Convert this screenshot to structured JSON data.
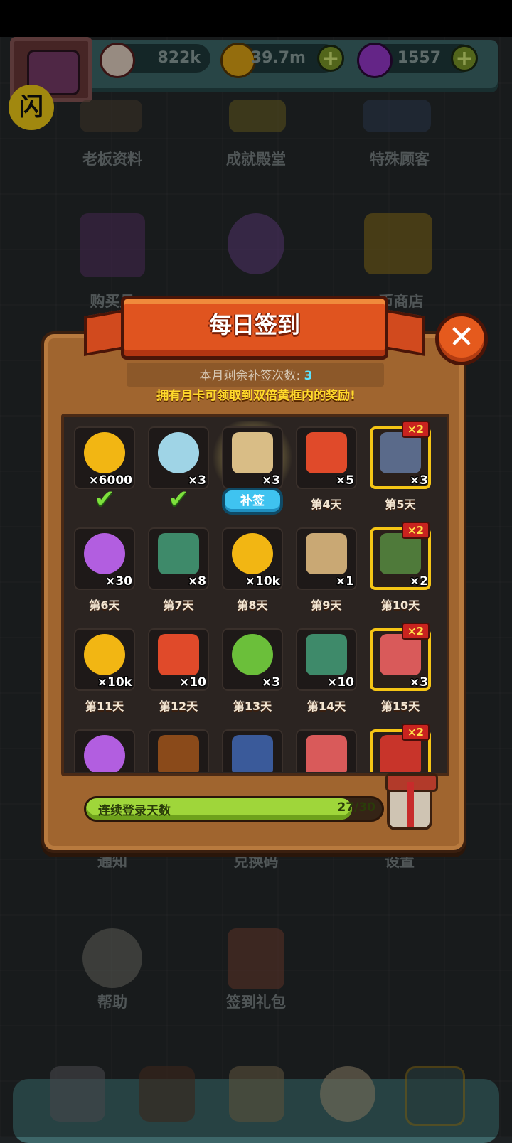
{
  "hud": {
    "eyes": "822k",
    "coins": "39.7m",
    "potions": "1557"
  },
  "menu": {
    "boss_info": "老板资料",
    "achievement_hall": "成就殿堂",
    "special_customers": "特殊顾客",
    "buy_monthly_card": "购买月",
    "coin_shop": "币商店",
    "notice": "通知",
    "redeem_code": "兑换码",
    "settings": "设置",
    "help": "帮助",
    "signin_gift": "签到礼包"
  },
  "dialog": {
    "title": "每日签到",
    "remaining_label": "本月剩余补签次数:",
    "remaining_count": "3",
    "hint": "拥有月卡可领取到双倍黄框内的奖励!",
    "resign_label": "补签",
    "double_badge": "×2",
    "progress_label": "连续登录天数",
    "progress_count": "27/30",
    "progress_fraction": 0.9
  },
  "days": [
    {
      "qty": "×6000",
      "day": "",
      "status": "claimed",
      "icon": "gold-coin-icon",
      "color": "#f2b613",
      "gold": false
    },
    {
      "qty": "×3",
      "day": "",
      "status": "claimed",
      "icon": "crystal-orb-icon",
      "color": "#9fd4e6",
      "gold": false
    },
    {
      "qty": "×3",
      "day": "",
      "status": "resign",
      "icon": "treasure-map-icon",
      "color": "#d9bd86",
      "gold": false
    },
    {
      "qty": "×5",
      "day": "第4天",
      "status": "pending",
      "icon": "capsule-icon",
      "color": "#e04a2a",
      "gold": false
    },
    {
      "qty": "×3",
      "day": "第5天",
      "status": "pending",
      "icon": "hero-card-icon",
      "color": "#5a6a8a",
      "gold": true
    },
    {
      "qty": "×30",
      "day": "第6天",
      "status": "pending",
      "icon": "purple-potion-icon",
      "color": "#b25ee0",
      "gold": false
    },
    {
      "qty": "×8",
      "day": "第7天",
      "status": "pending",
      "icon": "blueprint-icon",
      "color": "#3e8a6a",
      "gold": false
    },
    {
      "qty": "×10k",
      "day": "第8天",
      "status": "pending",
      "icon": "gold-coin-icon",
      "color": "#f2b613",
      "gold": false
    },
    {
      "qty": "×1",
      "day": "第9天",
      "status": "pending",
      "icon": "ticket-icon",
      "color": "#c9a874",
      "gold": false
    },
    {
      "qty": "×2",
      "day": "第10天",
      "status": "pending",
      "icon": "monster-card-icon",
      "color": "#4f7a3a",
      "gold": true
    },
    {
      "qty": "×10k",
      "day": "第11天",
      "status": "pending",
      "icon": "gold-coin-icon",
      "color": "#f2b613",
      "gold": false
    },
    {
      "qty": "×10",
      "day": "第12天",
      "status": "pending",
      "icon": "capsule-icon",
      "color": "#e04a2a",
      "gold": false
    },
    {
      "qty": "×3",
      "day": "第13天",
      "status": "pending",
      "icon": "green-potion-icon",
      "color": "#6bbf3a",
      "gold": false
    },
    {
      "qty": "×10",
      "day": "第14天",
      "status": "pending",
      "icon": "blueprint-icon",
      "color": "#3e8a6a",
      "gold": false
    },
    {
      "qty": "×3",
      "day": "第15天",
      "status": "pending",
      "icon": "scroll-icon",
      "color": "#d95a5a",
      "gold": true
    },
    {
      "qty": "",
      "day": "",
      "status": "pending",
      "icon": "purple-potion-icon",
      "color": "#b25ee0",
      "gold": false
    },
    {
      "qty": "",
      "day": "",
      "status": "pending",
      "icon": "herb-icon",
      "color": "#8a4a1a",
      "gold": false
    },
    {
      "qty": "",
      "day": "",
      "status": "pending",
      "icon": "hero-card-icon",
      "color": "#3a5a9a",
      "gold": false
    },
    {
      "qty": "",
      "day": "",
      "status": "pending",
      "icon": "scroll-icon",
      "color": "#d95a5a",
      "gold": false
    },
    {
      "qty": "",
      "day": "",
      "status": "pending",
      "icon": "red-chest-icon",
      "color": "#c8342a",
      "gold": true
    }
  ]
}
